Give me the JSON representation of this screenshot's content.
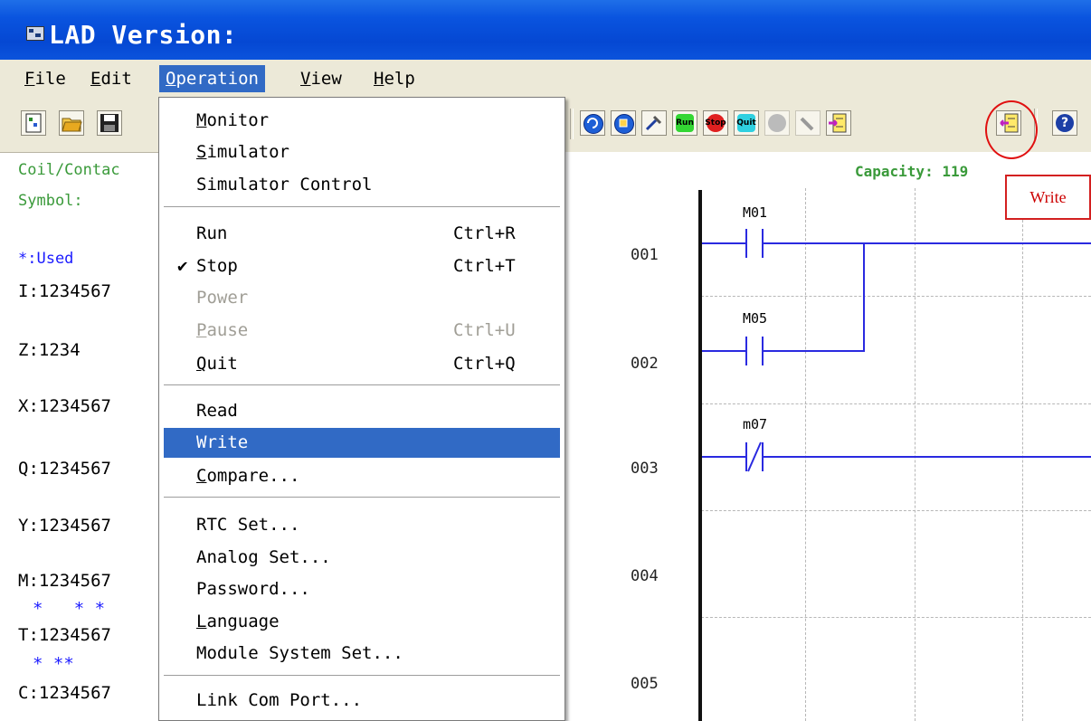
{
  "window": {
    "title": "LAD Version:",
    "title_icon": "app-window-icon"
  },
  "menubar": {
    "items": [
      {
        "label": "File",
        "key": "F"
      },
      {
        "label": "Edit",
        "key": "E"
      },
      {
        "label": "Operation",
        "key": "O",
        "active": true
      },
      {
        "label": "View",
        "key": "V"
      },
      {
        "label": "Help",
        "key": "H"
      }
    ]
  },
  "toolbar": {
    "buttons": [
      "new-icon",
      "open-icon",
      "save-icon",
      "connect-icon",
      "refresh-icon",
      "tool-icon",
      "run-icon",
      "stop-icon",
      "quit-icon",
      "power-icon",
      "pause-icon",
      "read-icon",
      "write-icon",
      "help-icon"
    ],
    "run_label": "Run",
    "stop_label": "Stop",
    "quit_label": "Quit"
  },
  "operation_menu": {
    "items": [
      {
        "label": "Monitor",
        "shortcut": ""
      },
      {
        "label": "Simulator",
        "shortcut": ""
      },
      {
        "label": "Simulator Control",
        "shortcut": ""
      },
      {
        "label": "Run",
        "shortcut": "Ctrl+R"
      },
      {
        "label": "Stop",
        "shortcut": "Ctrl+T",
        "checked": true,
        "check_mark": "✔"
      },
      {
        "label": "Power",
        "shortcut": "",
        "disabled": true
      },
      {
        "label": "Pause",
        "shortcut": "Ctrl+U",
        "disabled": true
      },
      {
        "label": "Quit",
        "shortcut": "Ctrl+Q"
      },
      {
        "label": "Read",
        "shortcut": ""
      },
      {
        "label": "Write",
        "shortcut": "",
        "highlighted": true
      },
      {
        "label": "Compare...",
        "shortcut": ""
      },
      {
        "label": "RTC Set...",
        "shortcut": ""
      },
      {
        "label": "Analog Set...",
        "shortcut": ""
      },
      {
        "label": "Password...",
        "shortcut": ""
      },
      {
        "label": "Language",
        "shortcut": ""
      },
      {
        "label": "Module System Set...",
        "shortcut": ""
      },
      {
        "label": "Link Com Port...",
        "shortcut": ""
      }
    ]
  },
  "left_panel": {
    "coil_contact": "Coil/Contac",
    "symbol": "Symbol:",
    "used_legend": "*:Used",
    "I": "I:1234567",
    "Z": "Z:1234",
    "X": "X:1234567",
    "Q": "Q:1234567",
    "Y": "Y:1234567",
    "M": "M:1234567",
    "M_used": "*   * *",
    "T": "T:1234567",
    "T_used": "* **",
    "C": "C:1234567"
  },
  "ladder": {
    "capacity": "Capacity: 119",
    "rows": [
      "001",
      "002",
      "003",
      "004",
      "005"
    ],
    "contacts": [
      {
        "label": "M01",
        "row": 1,
        "type": "NO"
      },
      {
        "label": "M05",
        "row": 2,
        "type": "NO"
      },
      {
        "label": "m07",
        "row": 3,
        "type": "NC"
      }
    ]
  },
  "annotation": {
    "write_tooltip": "Write"
  },
  "colors": {
    "title_bar": "#0a54df",
    "menu_highlight": "#316ac5",
    "rung_line": "#2a2ae0",
    "label_green": "#3a9a3a",
    "used_blue": "#1a1aff",
    "annotation_red": "#d32020"
  }
}
